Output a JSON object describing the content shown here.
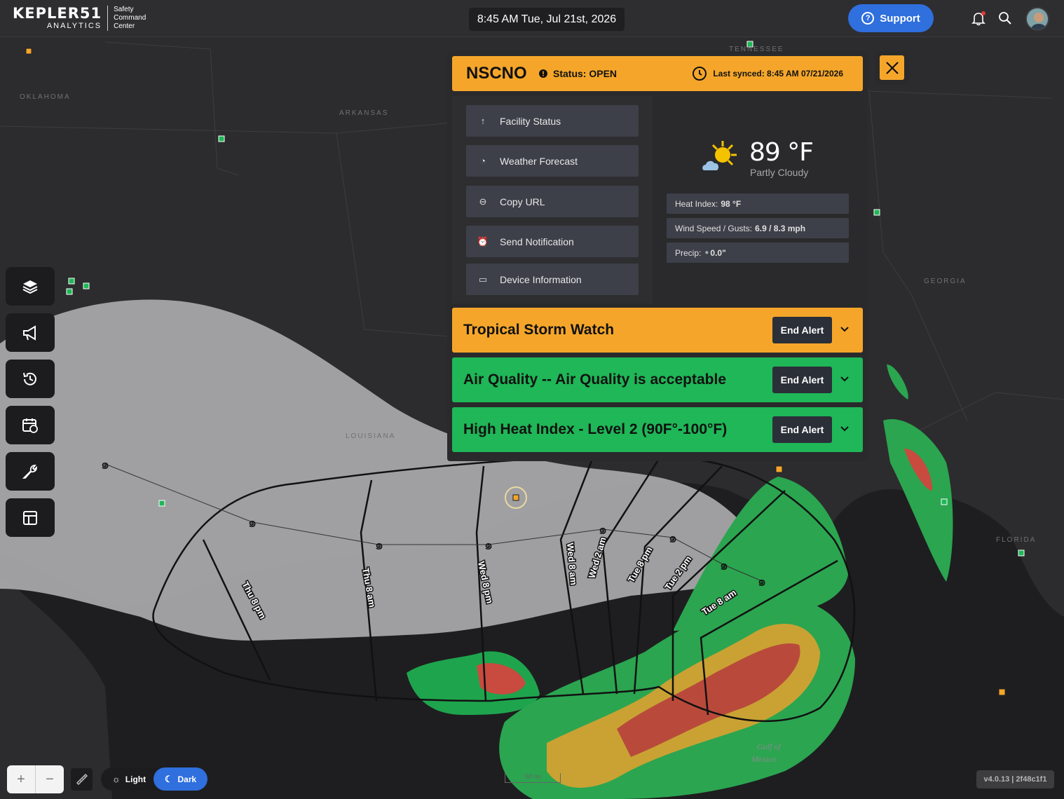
{
  "header": {
    "brand_name": "KEPLER51",
    "brand_sub": "ANALYTICS",
    "brand_tag_1": "Safety",
    "brand_tag_2": "Command",
    "brand_tag_3": "Center",
    "datetime": "8:45 AM Tue, Jul 21st, 2026",
    "support_label": "Support"
  },
  "map": {
    "labels": [
      "OKLAHOMA",
      "ARKANSAS",
      "TENNESSEE",
      "GEORGIA",
      "LOUISIANA",
      "FLORIDA",
      "Gulf of",
      "Mexico"
    ],
    "track_labels": [
      "Thu 8 pm",
      "Thu 8 am",
      "Wed 8 pm",
      "Wed 8 am",
      "Wed 2 am",
      "Tue 8 pm",
      "Tue 2 pm",
      "Tue 8 am"
    ],
    "scale_text": "50 mi"
  },
  "panel": {
    "facility_code": "NSCNO",
    "status_text": "Status: OPEN",
    "last_synced": "Last synced: 8:45 AM 07/21/2026",
    "menu": [
      {
        "label": "Facility Status",
        "icon": "arrow-up-icon"
      },
      {
        "label": "Weather Forecast",
        "icon": "gauge-icon"
      },
      {
        "label": "Copy URL",
        "icon": "link-icon"
      },
      {
        "label": "Send Notification",
        "icon": "alarm-icon"
      },
      {
        "label": "Device Information",
        "icon": "device-info-icon"
      }
    ],
    "weather": {
      "temperature": "89 °F",
      "condition": "Partly Cloudy",
      "heat_index_label": "Heat Index:",
      "heat_index_value": "98 °F",
      "wind_label": "Wind Speed / Gusts:",
      "wind_value": "6.9 / 8.3 mph",
      "precip_label": "Precip:",
      "precip_value": "0.0\""
    },
    "alerts": [
      {
        "title": "Tropical Storm Watch",
        "button": "End Alert",
        "color": "#f5a62a"
      },
      {
        "title": "Air Quality -- Air Quality is acceptable",
        "button": "End Alert",
        "color": "#1fb757"
      },
      {
        "title": "High Heat Index - Level 2 (90F°-100°F)",
        "button": "End Alert",
        "color": "#1fb757"
      }
    ]
  },
  "footer": {
    "zoom_in": "+",
    "zoom_out": "−",
    "theme_light": "Light",
    "theme_dark": "Dark",
    "version": "v4.0.13 | 2f48c1f1"
  },
  "colors": {
    "accent_orange": "#f5a62a",
    "accent_green": "#1fb757",
    "accent_blue": "#2f6fde",
    "map_bg": "#2b2b2d"
  }
}
